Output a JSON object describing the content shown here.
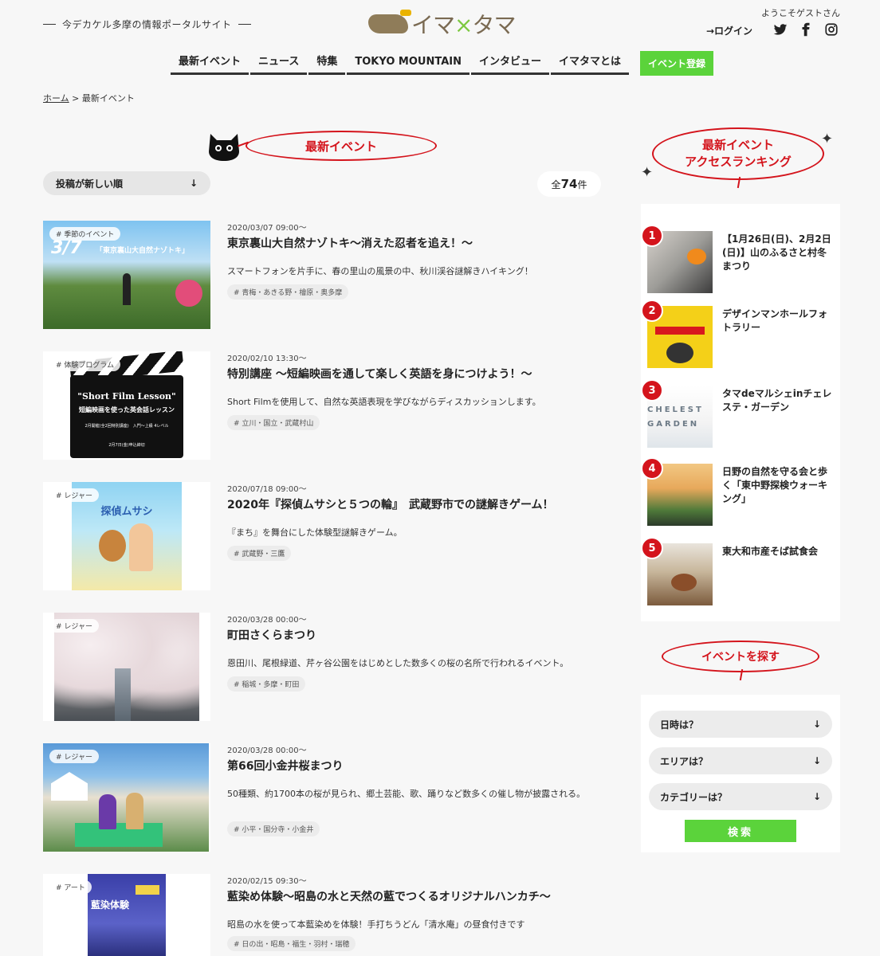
{
  "header": {
    "tagline": "今デカケル多摩の情報ポータルサイト",
    "logo_text_a": "イマ",
    "logo_text_x": "×",
    "logo_text_b": "タマ",
    "welcome": "ようこそゲストさん",
    "login": "→ログイン"
  },
  "nav": {
    "items": [
      "最新イベント",
      "ニュース",
      "特集",
      "TOKYO MOUNTAIN",
      "インタビュー",
      "イマタマとは"
    ],
    "register": "イベント登録"
  },
  "breadcrumb": {
    "home": "ホーム",
    "sep": " > ",
    "current": "最新イベント"
  },
  "section_title": "最新イベント",
  "sort": {
    "label": "投稿が新しい順"
  },
  "count": {
    "prefix": "全",
    "value": "74",
    "suffix": "件"
  },
  "events": [
    {
      "tag": "# 季節のイベント",
      "date": "2020/03/07 09:00〜",
      "title": "東京裏山大自然ナゾトキ〜消えた忍者を追え！〜",
      "desc": "スマートフォンを片手に、春の里山の風景の中、秋川渓谷謎解きハイキング！",
      "area": "# 青梅・あきる野・檜原・奥多摩"
    },
    {
      "tag": "# 体験プログラム",
      "date": "2020/02/10 13:30〜",
      "title": "特別講座 〜短編映画を通して楽しく英語を身につけよう！〜",
      "desc": "Short Filmを使用して、自然な英語表現を学びながらディスカッションします。",
      "area": "# 立川・国立・武蔵村山"
    },
    {
      "tag": "# レジャー",
      "date": "2020/07/18 09:00〜",
      "title": "2020年『探偵ムサシと５つの輪』　武蔵野市での謎解きゲーム！",
      "desc": "『まち』を舞台にした体験型謎解きゲーム。",
      "area": "# 武蔵野・三鷹"
    },
    {
      "tag": "# レジャー",
      "date": "2020/03/28 00:00〜",
      "title": "町田さくらまつり",
      "desc": "恩田川、尾根緑道、芹ヶ谷公園をはじめとした数多くの桜の名所で行われるイベント。",
      "area": "# 稲城・多摩・町田"
    },
    {
      "tag": "# レジャー",
      "date": "2020/03/28 00:00〜",
      "title": "第66回小金井桜まつり",
      "desc": "50種類、約1700本の桜が見られ、郷土芸能、歌、踊りなど数多くの催し物が披露される。",
      "area": "# 小平・国分寺・小金井"
    },
    {
      "tag": "# アート",
      "date": "2020/02/15 09:30〜",
      "title": "藍染め体験〜昭島の水と天然の藍でつくるオリジナルハンカチ〜",
      "desc": "昭島の水を使って本藍染めを体験！手打ちうどん「清水庵」の昼食付きです",
      "area": "# 日の出・昭島・福生・羽村・瑞穂"
    }
  ],
  "thumb_texts": {
    "e1_date": "3/7",
    "e1_title": "「東京裏山大自然ナゾトキ」",
    "e2_line1": "\"Short Film Lesson\"",
    "e2_line2": "短編映画を使った英会話レッスン",
    "e2_line3": "2月開催(全2回特別講座)　入門〜上級 4レベル",
    "e2_line4": "2月7日(金)申込締切",
    "e3_title": "探偵ムサシ",
    "e6_title": "藍染体験"
  },
  "sidebar": {
    "ranking_title_1": "最新イベント",
    "ranking_title_2": "アクセスランキング",
    "ranking": [
      {
        "num": "1",
        "title": "【1月26日(日)、2月2日(日)】山のふるさと村冬まつり"
      },
      {
        "num": "2",
        "title": "デザインマンホールフォトラリー"
      },
      {
        "num": "3",
        "title": "タマdeマルシェinチェレステ・ガーデン"
      },
      {
        "num": "4",
        "title": "日野の自然を守る会と歩く「東中野探検ウォーキング」"
      },
      {
        "num": "5",
        "title": "東大和市産そば試食会"
      }
    ],
    "rank3_thumb": "CHELEST GARDEN",
    "search_title": "イベントを探す",
    "selects": [
      "日時は？",
      "エリアは？",
      "カテゴリーは？"
    ],
    "search_button": "検索"
  },
  "colors": {
    "accent_red": "#d4141c",
    "green": "#5bd33b"
  }
}
